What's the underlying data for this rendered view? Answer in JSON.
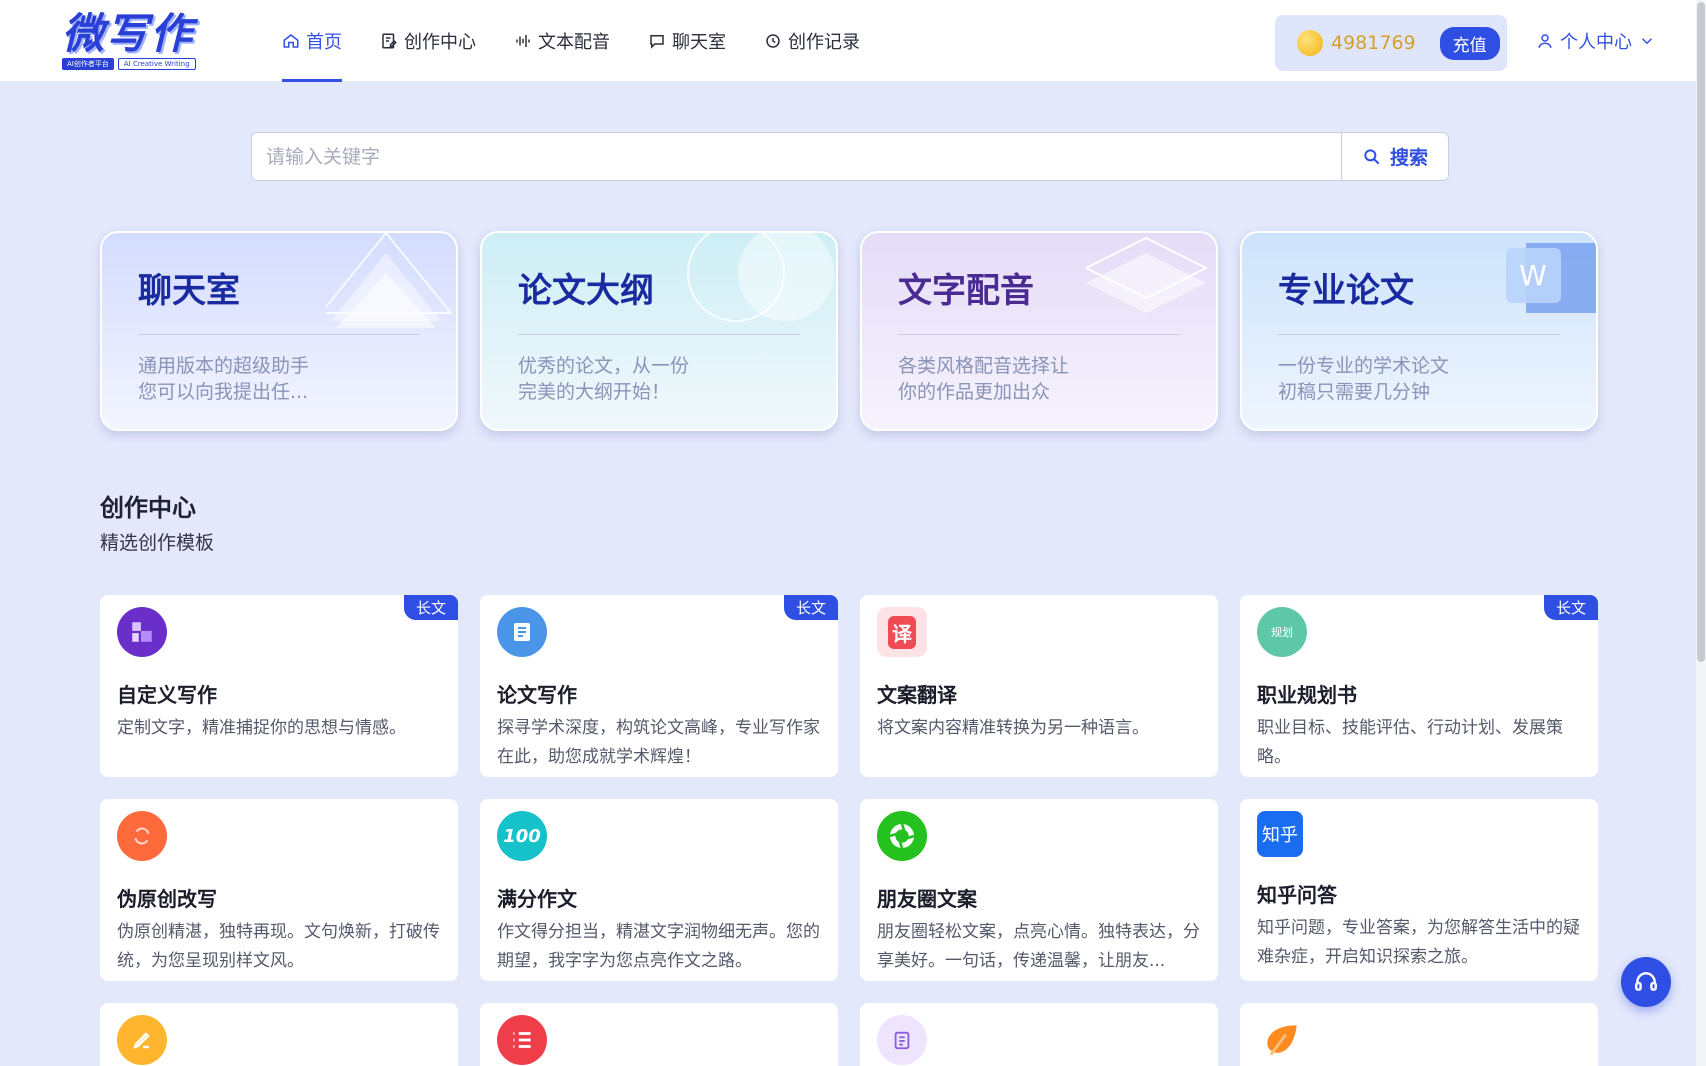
{
  "logo": {
    "main": "微写作",
    "sub1": "AI创作者平台",
    "sub2": "AI Creative Writing"
  },
  "nav": [
    {
      "label": "首页",
      "icon": "home-icon",
      "active": true
    },
    {
      "label": "创作中心",
      "icon": "edit-doc-icon",
      "active": false
    },
    {
      "label": "文本配音",
      "icon": "audio-wave-icon",
      "active": false
    },
    {
      "label": "聊天室",
      "icon": "chat-bubble-icon",
      "active": false
    },
    {
      "label": "创作记录",
      "icon": "history-icon",
      "active": false
    }
  ],
  "account": {
    "coins": "4981769",
    "recharge_label": "充值",
    "user_center_label": "个人中心"
  },
  "search": {
    "placeholder": "请输入关键字",
    "button_label": "搜索"
  },
  "features": [
    {
      "title": "聊天室",
      "desc1": "通用版本的超级助手",
      "desc2": "您可以向我提出任..."
    },
    {
      "title": "论文大纲",
      "desc1": "优秀的论文，从一份",
      "desc2": "完美的大纲开始！"
    },
    {
      "title": "文字配音",
      "desc1": "各类风格配音选择让",
      "desc2": "你的作品更加出众"
    },
    {
      "title": "专业论文",
      "desc1": "一份专业的学术论文",
      "desc2": "初稿只需要几分钟"
    }
  ],
  "section": {
    "title": "创作中心",
    "subtitle": "精选创作模板"
  },
  "templates": [
    {
      "title": "自定义写作",
      "desc": "定制文字，精准捕捉你的思想与情感。",
      "badge": "长文",
      "color": "#6a2fc8",
      "icon": "puzzle-icon"
    },
    {
      "title": "论文写作",
      "desc": "探寻学术深度，构筑论文高峰，专业写作家在此，助您成就学术辉煌！",
      "badge": "长文",
      "color": "#4b95e8",
      "icon": "paper-icon"
    },
    {
      "title": "文案翻译",
      "desc": "将文案内容精准转换为另一种语言。",
      "badge": "",
      "color": "#f04b55",
      "icon": "translate-icon",
      "glyph": "译"
    },
    {
      "title": "职业规划书",
      "desc": "职业目标、技能评估、行动计划、发展策略。",
      "badge": "长文",
      "color": "#5ec7a8",
      "icon": "plan-icon",
      "glyph": "规划"
    },
    {
      "title": "伪原创改写",
      "desc": "伪原创精湛，独特再现。文句焕新，打破传统，为您呈现别样文风。",
      "badge": "",
      "color": "#ff6a3d",
      "icon": "rewrite-icon"
    },
    {
      "title": "满分作文",
      "desc": "作文得分担当，精湛文字润物细无声。您的期望，我字字为您点亮作文之路。",
      "badge": "",
      "color": "#16c2c9",
      "icon": "hundred-icon",
      "glyph": "100"
    },
    {
      "title": "朋友圈文案",
      "desc": "朋友圈轻松文案，点亮心情。独特表达，分享美好。一句话，传递温馨，让朋友...",
      "badge": "",
      "color": "#25c21f",
      "icon": "moments-icon"
    },
    {
      "title": "知乎问答",
      "desc": "知乎问题，专业答案，为您解答生活中的疑难杂症，开启知识探索之旅。",
      "badge": "",
      "color": "#1a6df0",
      "icon": "zhihu-icon",
      "glyph": "知乎"
    },
    {
      "title": "",
      "desc": "",
      "badge": "",
      "color": "#ffb52e",
      "icon": "pen-icon"
    },
    {
      "title": "",
      "desc": "",
      "badge": "",
      "color": "#ef3e4a",
      "icon": "list-icon"
    },
    {
      "title": "",
      "desc": "",
      "badge": "",
      "color": "#e8dcfb",
      "icon": "clipboard-icon"
    },
    {
      "title": "",
      "desc": "",
      "badge": "",
      "color": "#ff8a1f",
      "icon": "leaf-icon"
    }
  ],
  "support": {
    "icon": "headset-icon"
  }
}
